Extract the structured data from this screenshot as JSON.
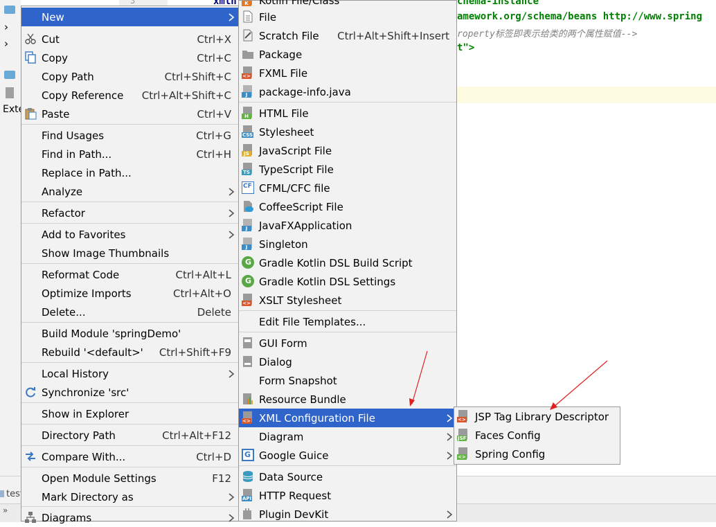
{
  "editor": {
    "line_number": "3",
    "line1_start": "xmln",
    "line1_end": "chema-instance",
    "line2_end": "amework.org/schema/beans http://www.spring",
    "line3_end": "roperty标签即表示给类的两个属性赋值-->",
    "line4_end": "t\">"
  },
  "left_panel": {
    "label": "Exte"
  },
  "bottom_panel": {
    "tab_label": "test"
  },
  "colors": {
    "selection": "#2f65ca",
    "menu_bg": "#f2f2f2",
    "arrow_red": "#e02020"
  },
  "context_menu": {
    "items": [
      {
        "label": "New",
        "selected": true
      },
      {
        "label": "Cut",
        "shortcut": "Ctrl+X",
        "icon": "scissors-icon"
      },
      {
        "label": "Copy",
        "shortcut": "Ctrl+C",
        "icon": "copy-icon"
      },
      {
        "label": "Copy Path",
        "shortcut": "Ctrl+Shift+C"
      },
      {
        "label": "Copy Reference",
        "shortcut": "Ctrl+Alt+Shift+C"
      },
      {
        "label": "Paste",
        "shortcut": "Ctrl+V",
        "icon": "paste-icon"
      },
      {
        "label": "Find Usages",
        "shortcut": "Ctrl+G"
      },
      {
        "label": "Find in Path...",
        "shortcut": "Ctrl+H"
      },
      {
        "label": "Replace in Path..."
      },
      {
        "label": "Analyze"
      },
      {
        "label": "Refactor"
      },
      {
        "label": "Add to Favorites"
      },
      {
        "label": "Show Image Thumbnails"
      },
      {
        "label": "Reformat Code",
        "shortcut": "Ctrl+Alt+L"
      },
      {
        "label": "Optimize Imports",
        "shortcut": "Ctrl+Alt+O"
      },
      {
        "label": "Delete...",
        "shortcut": "Delete"
      },
      {
        "label": "Build Module 'springDemo'"
      },
      {
        "label": "Rebuild '<default>'",
        "shortcut": "Ctrl+Shift+F9"
      },
      {
        "label": "Local History"
      },
      {
        "label": "Synchronize 'src'",
        "icon": "sync-icon"
      },
      {
        "label": "Show in Explorer"
      },
      {
        "label": "Directory Path",
        "shortcut": "Ctrl+Alt+F12"
      },
      {
        "label": "Compare With...",
        "shortcut": "Ctrl+D",
        "icon": "compare-icon"
      },
      {
        "label": "Open Module Settings",
        "shortcut": "F12"
      },
      {
        "label": "Mark Directory as"
      },
      {
        "label": "Diagrams",
        "icon": "diagram-icon"
      }
    ]
  },
  "new_submenu": {
    "items": [
      {
        "label": "Kotlin File/Class"
      },
      {
        "label": "File"
      },
      {
        "label": "Scratch File",
        "shortcut": "Ctrl+Alt+Shift+Insert"
      },
      {
        "label": "Package"
      },
      {
        "label": "FXML File"
      },
      {
        "label": "package-info.java"
      },
      {
        "label": "HTML File",
        "tag": "H"
      },
      {
        "label": "Stylesheet",
        "tag": "CSS"
      },
      {
        "label": "JavaScript File",
        "tag": "JS"
      },
      {
        "label": "TypeScript File",
        "tag": "TS"
      },
      {
        "label": "CFML/CFC file",
        "tag": "CF"
      },
      {
        "label": "CoffeeScript File"
      },
      {
        "label": "JavaFXApplication",
        "tag": "J"
      },
      {
        "label": "Singleton",
        "tag": "J"
      },
      {
        "label": "Gradle Kotlin DSL Build Script",
        "tag": "G"
      },
      {
        "label": "Gradle Kotlin DSL Settings",
        "tag": "G"
      },
      {
        "label": "XSLT Stylesheet"
      },
      {
        "label": "Edit File Templates..."
      },
      {
        "label": "GUI Form"
      },
      {
        "label": "Dialog"
      },
      {
        "label": "Form Snapshot"
      },
      {
        "label": "Resource Bundle"
      },
      {
        "label": "XML Configuration File",
        "selected": true
      },
      {
        "label": "Diagram"
      },
      {
        "label": "Google Guice",
        "tag": "G"
      },
      {
        "label": "Data Source"
      },
      {
        "label": "HTTP Request",
        "tag": "API"
      },
      {
        "label": "Plugin DevKit"
      }
    ]
  },
  "xml_submenu": {
    "items": [
      {
        "label": "JSP Tag Library Descriptor"
      },
      {
        "label": "Faces Config",
        "tag": "JSF"
      },
      {
        "label": "Spring Config"
      }
    ]
  }
}
